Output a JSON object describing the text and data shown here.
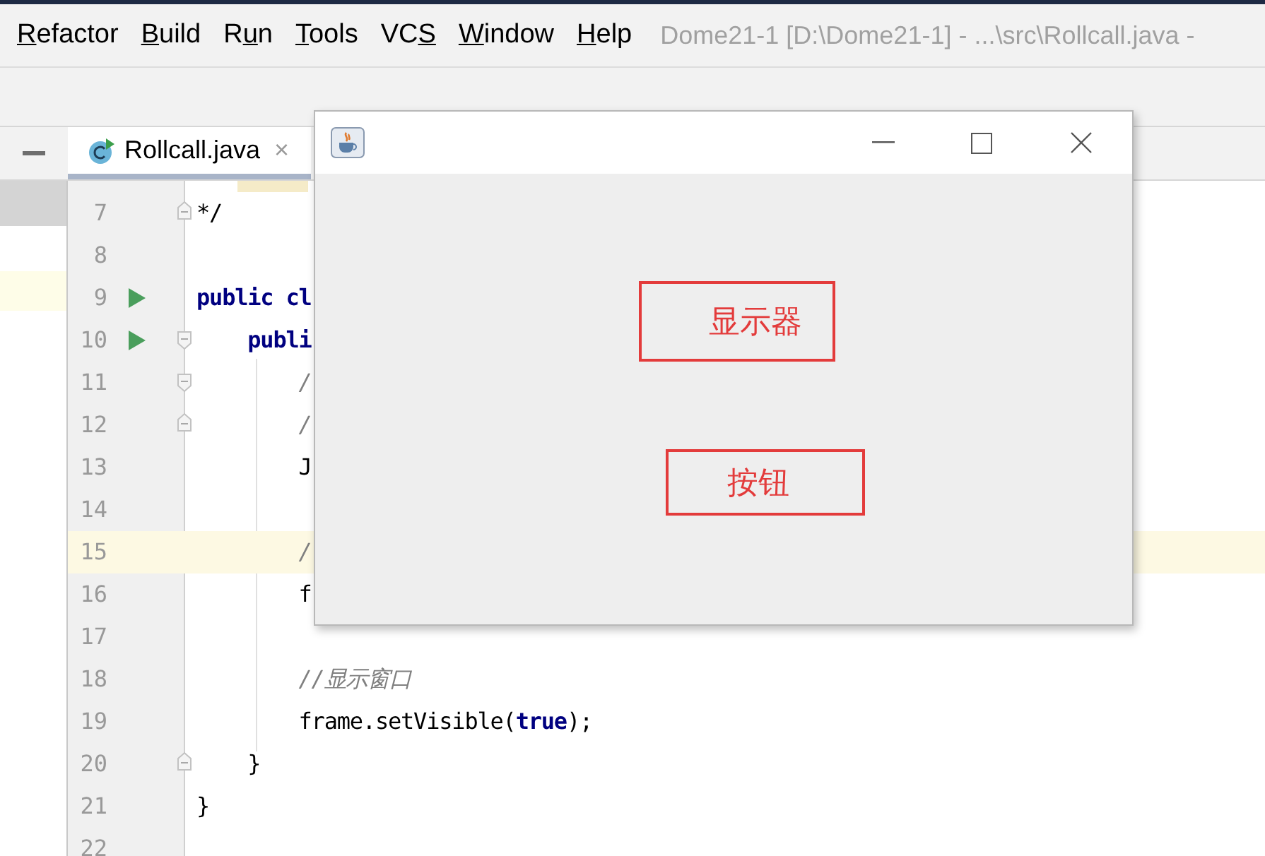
{
  "menu": [
    {
      "key": "R",
      "post": "efactor"
    },
    {
      "key": "B",
      "post": "uild"
    },
    {
      "pre": "R",
      "key": "u",
      "post": "n"
    },
    {
      "key": "T",
      "post": "ools"
    },
    {
      "pre": "VC",
      "key": "S"
    },
    {
      "key": "W",
      "post": "indow"
    },
    {
      "key": "H",
      "post": "elp"
    }
  ],
  "title": "Dome21-1 [D:\\Dome21-1] - ...\\src\\Rollcall.java -",
  "tabs": [
    {
      "label": "Rollcall.java",
      "selected": true,
      "close": "×"
    }
  ],
  "editor": {
    "lines": [
      {
        "number": "7",
        "kind": "fold-end",
        "run": false,
        "highlighted": false,
        "parts": [
          {
            "text": "*/",
            "kind": "plain"
          }
        ]
      },
      {
        "number": "8",
        "kind": "plain",
        "run": false,
        "highlighted": false
      },
      {
        "number": "9",
        "kind": "plain",
        "run": true,
        "highlighted": false,
        "parts": [
          {
            "text": "public",
            "kind": "keyword"
          },
          {
            "text": " cl",
            "kind": "keyword"
          }
        ]
      },
      {
        "number": "10",
        "kind": "fold-start",
        "run": true,
        "highlighted": false,
        "parts": [
          {
            "text": "    publi",
            "kind": "keyword"
          }
        ]
      },
      {
        "number": "11",
        "kind": "fold-start",
        "run": false,
        "highlighted": false,
        "parts": [
          {
            "text": "        /",
            "kind": "comment"
          }
        ]
      },
      {
        "number": "12",
        "kind": "fold-end",
        "run": false,
        "highlighted": false,
        "parts": [
          {
            "text": "        /",
            "kind": "comment"
          }
        ]
      },
      {
        "number": "13",
        "kind": "plain",
        "run": false,
        "highlighted": false,
        "parts": [
          {
            "text": "        J",
            "kind": "plain"
          }
        ]
      },
      {
        "number": "14",
        "kind": "plain",
        "run": false,
        "highlighted": false
      },
      {
        "number": "15",
        "kind": "plain",
        "run": false,
        "highlighted": true,
        "parts": [
          {
            "text": "        /",
            "kind": "comment"
          }
        ]
      },
      {
        "number": "16",
        "kind": "plain",
        "run": false,
        "highlighted": false,
        "parts": [
          {
            "text": "        f",
            "kind": "plain"
          }
        ]
      },
      {
        "number": "17",
        "kind": "plain",
        "run": false,
        "highlighted": false
      },
      {
        "number": "18",
        "kind": "plain",
        "run": false,
        "highlighted": false,
        "parts": [
          {
            "text": "        //显示窗口",
            "kind": "comment"
          }
        ]
      },
      {
        "number": "19",
        "kind": "plain",
        "run": false,
        "highlighted": false,
        "parts": [
          {
            "text": "        frame.setVisible(",
            "kind": "plain"
          },
          {
            "text": "true",
            "kind": "keyword"
          },
          {
            "text": ");",
            "kind": "plain"
          }
        ]
      },
      {
        "number": "20",
        "kind": "fold-end",
        "run": false,
        "highlighted": false,
        "parts": [
          {
            "text": "    }",
            "kind": "plain"
          }
        ]
      },
      {
        "number": "21",
        "kind": "plain",
        "run": false,
        "highlighted": false,
        "parts": [
          {
            "text": "}",
            "kind": "plain"
          }
        ]
      },
      {
        "number": "22",
        "kind": "plain",
        "run": false,
        "highlighted": false
      }
    ]
  },
  "frame": {
    "labels": [
      {
        "text": "显示器",
        "kind": "label"
      },
      {
        "text": "按钮",
        "kind": "button"
      }
    ]
  }
}
